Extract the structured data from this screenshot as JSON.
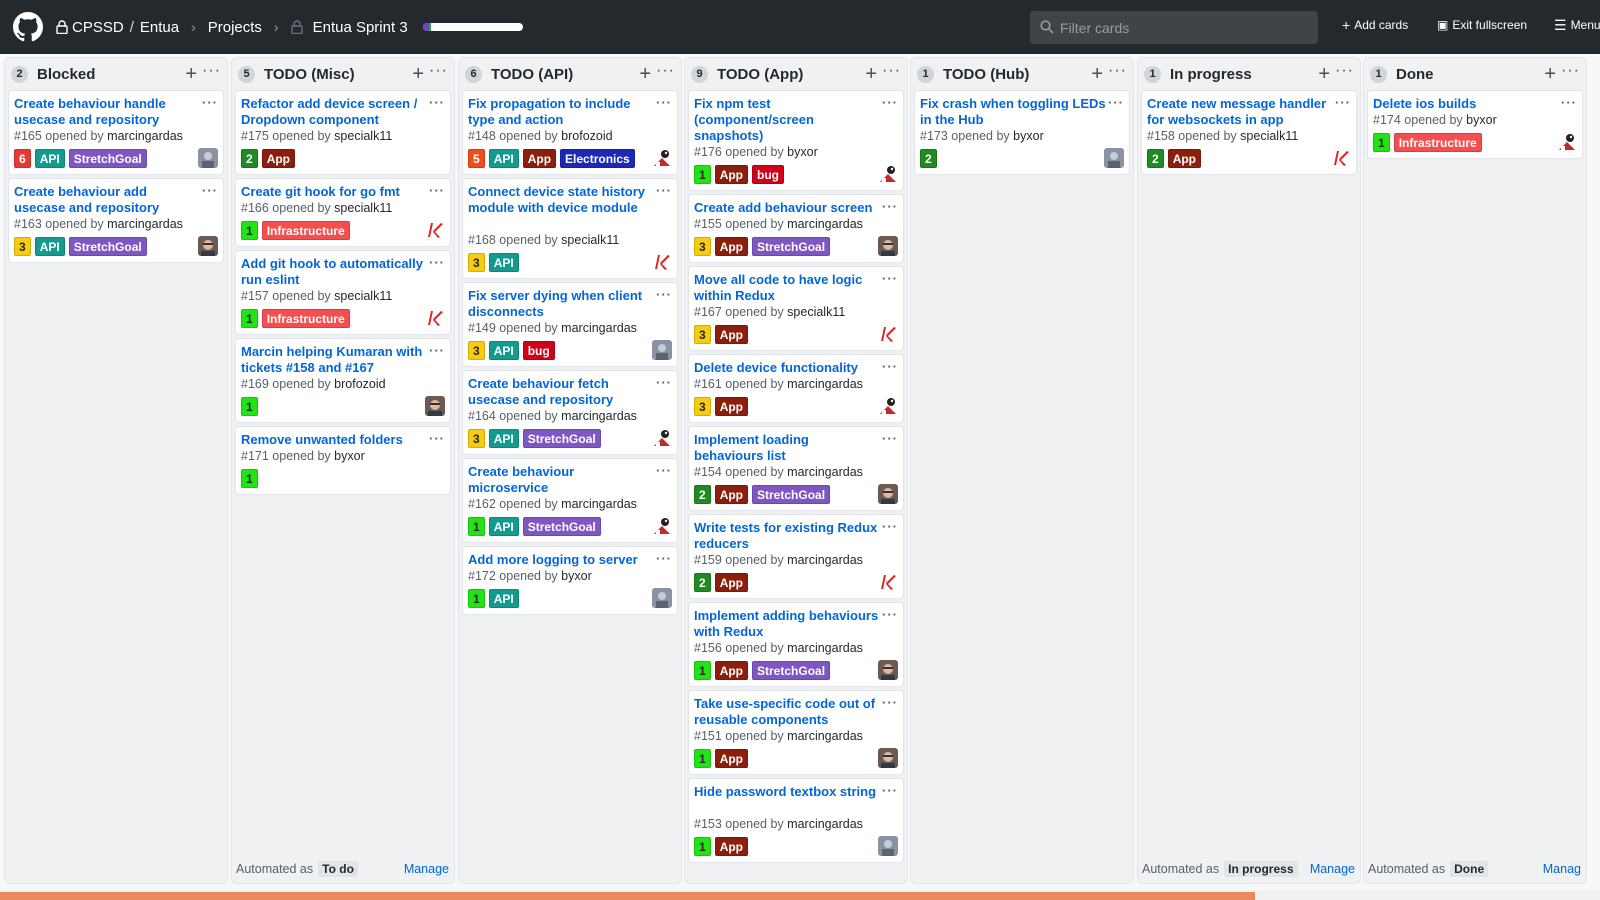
{
  "topbar": {
    "org": "CPSSD",
    "separator": "/",
    "repo": "Entua",
    "projects": "Projects",
    "project_name": "Entua Sprint 3",
    "progress": {
      "done": 0.06,
      "in_progress": 0.02,
      "todo": 0.92,
      "colors": {
        "done": "#6f42c1",
        "in_progress": "#28a745",
        "todo": "#ffffff"
      }
    },
    "filter_placeholder": "Filter cards",
    "add_cards": "Add cards",
    "exit_fullscreen": "Exit fullscreen",
    "menu": "Menu"
  },
  "label_colors": {
    "API": "#149b90",
    "StretchGoal": "#7e57c2",
    "App": "#8b1f0b",
    "Infrastructure": "#f44e4e",
    "Electronics": "#1b2ab5",
    "bug": "#d0021b",
    "p1": "#22e414",
    "p2": "#1f8b22",
    "p3": "#f6cb10",
    "p5": "#f14c1b",
    "p6": "#e53935"
  },
  "columns": [
    {
      "name": "Blocked",
      "count": "2",
      "automated": "",
      "manage": "",
      "cards": [
        {
          "title": "Create behaviour handle usecase and repository",
          "number": "#165",
          "opened_by": "opened by",
          "author": "marcingardas",
          "labels": [
            {
              "text": "6",
              "key": "p6"
            },
            {
              "text": "API",
              "key": "API"
            },
            {
              "text": "StretchGoal",
              "key": "StretchGoal"
            }
          ],
          "avatar": "photo-gray"
        },
        {
          "title": "Create behaviour add usecase and repository",
          "number": "#163",
          "opened_by": "opened by",
          "author": "marcingardas",
          "labels": [
            {
              "text": "3",
              "key": "p3"
            },
            {
              "text": "API",
              "key": "API"
            },
            {
              "text": "StretchGoal",
              "key": "StretchGoal"
            }
          ],
          "avatar": "photo-face"
        }
      ]
    },
    {
      "name": "TODO (Misc)",
      "count": "5",
      "automated": "Automated as",
      "automated_value": "To do",
      "manage": "Manage",
      "cards": [
        {
          "title": "Refactor add device screen / Dropdown component",
          "number": "#175",
          "opened_by": "opened by",
          "author": "specialk11",
          "labels": [
            {
              "text": "2",
              "key": "p2"
            },
            {
              "text": "App",
              "key": "App"
            }
          ],
          "avatar": ""
        },
        {
          "title": "Create git hook for go fmt",
          "number": "#166",
          "opened_by": "opened by",
          "author": "specialk11",
          "labels": [
            {
              "text": "1",
              "key": "p1"
            },
            {
              "text": "Infrastructure",
              "key": "Infrastructure"
            }
          ],
          "avatar": "k-logo"
        },
        {
          "title": "Add git hook to automatically run eslint",
          "number": "#157",
          "opened_by": "opened by",
          "author": "specialk11",
          "labels": [
            {
              "text": "1",
              "key": "p1"
            },
            {
              "text": "Infrastructure",
              "key": "Infrastructure"
            }
          ],
          "avatar": "k-logo"
        },
        {
          "title": "Marcin helping Kumaran with tickets #158 and #167",
          "number": "#169",
          "opened_by": "opened by",
          "author": "brofozoid",
          "labels": [
            {
              "text": "1",
              "key": "p1"
            }
          ],
          "avatar": "photo-face"
        },
        {
          "title": "Remove unwanted folders",
          "number": "#171",
          "opened_by": "opened by",
          "author": "byxor",
          "labels": [
            {
              "text": "1",
              "key": "p1"
            }
          ],
          "avatar": ""
        }
      ]
    },
    {
      "name": "TODO (API)",
      "count": "6",
      "automated": "",
      "manage": "",
      "cards": [
        {
          "title": "Fix propagation to include type and action",
          "number": "#148",
          "opened_by": "opened by",
          "author": "brofozoid",
          "labels": [
            {
              "text": "5",
              "key": "p5"
            },
            {
              "text": "API",
              "key": "API"
            },
            {
              "text": "App",
              "key": "App"
            },
            {
              "text": "Electronics",
              "key": "Electronics"
            }
          ],
          "avatar": "mascot"
        },
        {
          "title": "Connect device state history module with device module",
          "number": "#168",
          "opened_by": "opened by",
          "author": "specialk11",
          "labels": [
            {
              "text": "3",
              "key": "p3"
            },
            {
              "text": "API",
              "key": "API"
            }
          ],
          "avatar": "k-logo"
        },
        {
          "title": "Fix server dying when client disconnects",
          "number": "#149",
          "opened_by": "opened by",
          "author": "marcingardas",
          "labels": [
            {
              "text": "3",
              "key": "p3"
            },
            {
              "text": "API",
              "key": "API"
            },
            {
              "text": "bug",
              "key": "bug"
            }
          ],
          "avatar": "photo-gray"
        },
        {
          "title": "Create behaviour fetch usecase and repository",
          "number": "#164",
          "opened_by": "opened by",
          "author": "marcingardas",
          "labels": [
            {
              "text": "3",
              "key": "p3"
            },
            {
              "text": "API",
              "key": "API"
            },
            {
              "text": "StretchGoal",
              "key": "StretchGoal"
            }
          ],
          "avatar": "mascot"
        },
        {
          "title": "Create behaviour microservice",
          "number": "#162",
          "opened_by": "opened by",
          "author": "marcingardas",
          "labels": [
            {
              "text": "1",
              "key": "p1"
            },
            {
              "text": "API",
              "key": "API"
            },
            {
              "text": "StretchGoal",
              "key": "StretchGoal"
            }
          ],
          "avatar": "mascot"
        },
        {
          "title": "Add more logging to server",
          "number": "#172",
          "opened_by": "opened by",
          "author": "byxor",
          "labels": [
            {
              "text": "1",
              "key": "p1"
            },
            {
              "text": "API",
              "key": "API"
            }
          ],
          "avatar": "photo-gray"
        }
      ]
    },
    {
      "name": "TODO (App)",
      "count": "9",
      "automated": "",
      "manage": "",
      "cards": [
        {
          "title": "Fix npm test (component/screen snapshots)",
          "number": "#176",
          "opened_by": "opened by",
          "author": "byxor",
          "labels": [
            {
              "text": "1",
              "key": "p1"
            },
            {
              "text": "App",
              "key": "App"
            },
            {
              "text": "bug",
              "key": "bug"
            }
          ],
          "avatar": "mascot"
        },
        {
          "title": "Create add behaviour screen",
          "number": "#155",
          "opened_by": "opened by",
          "author": "marcingardas",
          "labels": [
            {
              "text": "3",
              "key": "p3"
            },
            {
              "text": "App",
              "key": "App"
            },
            {
              "text": "StretchGoal",
              "key": "StretchGoal"
            }
          ],
          "avatar": "photo-face"
        },
        {
          "title": "Move all code to have logic within Redux",
          "number": "#167",
          "opened_by": "opened by",
          "author": "specialk11",
          "labels": [
            {
              "text": "3",
              "key": "p3"
            },
            {
              "text": "App",
              "key": "App"
            }
          ],
          "avatar": "k-logo"
        },
        {
          "title": "Delete device functionality",
          "number": "#161",
          "opened_by": "opened by",
          "author": "marcingardas",
          "labels": [
            {
              "text": "3",
              "key": "p3"
            },
            {
              "text": "App",
              "key": "App"
            }
          ],
          "avatar": "mascot"
        },
        {
          "title": "Implement loading behaviours list",
          "number": "#154",
          "opened_by": "opened by",
          "author": "marcingardas",
          "labels": [
            {
              "text": "2",
              "key": "p2"
            },
            {
              "text": "App",
              "key": "App"
            },
            {
              "text": "StretchGoal",
              "key": "StretchGoal"
            }
          ],
          "avatar": "photo-face"
        },
        {
          "title": "Write tests for existing Redux reducers",
          "number": "#159",
          "opened_by": "opened by",
          "author": "marcingardas",
          "labels": [
            {
              "text": "2",
              "key": "p2"
            },
            {
              "text": "App",
              "key": "App"
            }
          ],
          "avatar": "k-logo"
        },
        {
          "title": "Implement adding behaviours with Redux",
          "number": "#156",
          "opened_by": "opened by",
          "author": "marcingardas",
          "labels": [
            {
              "text": "1",
              "key": "p1"
            },
            {
              "text": "App",
              "key": "App"
            },
            {
              "text": "StretchGoal",
              "key": "StretchGoal"
            }
          ],
          "avatar": "photo-face"
        },
        {
          "title": "Take use-specific code out of reusable components",
          "number": "#151",
          "opened_by": "opened by",
          "author": "marcingardas",
          "labels": [
            {
              "text": "1",
              "key": "p1"
            },
            {
              "text": "App",
              "key": "App"
            }
          ],
          "avatar": "photo-face"
        },
        {
          "title": "Hide password textbox string",
          "number": "#153",
          "opened_by": "opened by",
          "author": "marcingardas",
          "labels": [
            {
              "text": "1",
              "key": "p1"
            },
            {
              "text": "App",
              "key": "App"
            }
          ],
          "avatar": "photo-gray"
        }
      ]
    },
    {
      "name": "TODO (Hub)",
      "count": "1",
      "automated": "",
      "manage": "",
      "cards": [
        {
          "title": "Fix crash when toggling LEDs in the Hub",
          "number": "#173",
          "opened_by": "opened by",
          "author": "byxor",
          "labels": [
            {
              "text": "2",
              "key": "p2"
            }
          ],
          "avatar": "photo-gray"
        }
      ]
    },
    {
      "name": "In progress",
      "count": "1",
      "automated": "Automated as",
      "automated_value": "In progress",
      "manage": "Manage",
      "cards": [
        {
          "title": "Create new message handler for websockets in app",
          "number": "#158",
          "opened_by": "opened by",
          "author": "specialk11",
          "labels": [
            {
              "text": "2",
              "key": "p2"
            },
            {
              "text": "App",
              "key": "App"
            }
          ],
          "avatar": "k-logo"
        }
      ]
    },
    {
      "name": "Done",
      "count": "1",
      "automated": "Automated as",
      "automated_value": "Done",
      "manage": "Manag",
      "cards": [
        {
          "title": "Delete ios builds",
          "number": "#174",
          "opened_by": "opened by",
          "author": "byxor",
          "labels": [
            {
              "text": "1",
              "key": "p1"
            },
            {
              "text": "Infrastructure",
              "key": "Infrastructure"
            }
          ],
          "avatar": "mascot"
        }
      ]
    }
  ]
}
